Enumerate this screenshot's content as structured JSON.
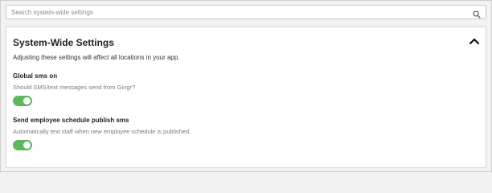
{
  "search": {
    "placeholder": "Search system-wide settings",
    "icon": "search-icon"
  },
  "section": {
    "title": "System-Wide Settings",
    "subtitle": "Adjusting these settings will affect all locations in your app.",
    "collapse_icon": "chevron-up-icon",
    "settings": [
      {
        "label": "Global sms on",
        "description": "Should SMS/text messages send from Gingr?",
        "enabled": true
      },
      {
        "label": "Send employee schedule publish sms",
        "description": "Automatically text staff when new employee schedule is published.",
        "enabled": true
      }
    ]
  },
  "colors": {
    "toggle_on": "#5cb85c",
    "card_bg": "#ffffff",
    "page_bg": "#f2f2f2"
  }
}
